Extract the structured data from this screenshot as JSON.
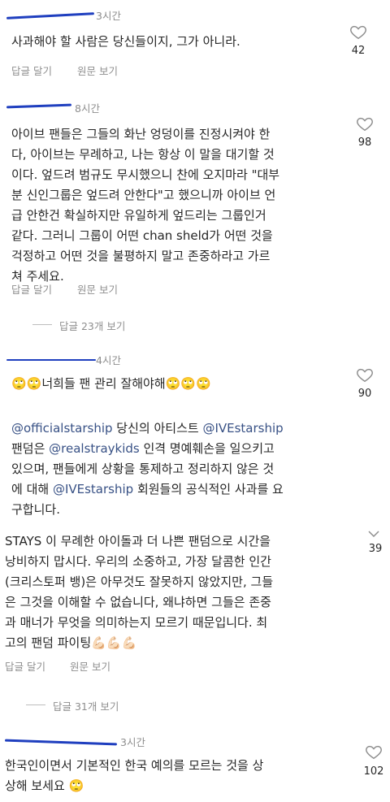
{
  "comments": [
    {
      "time": "3시간",
      "text": "사과해야 할 사람은 당신들이지, 그가 아니라.",
      "likes": "42",
      "reply_label": "답글 달기",
      "original_label": "원문 보기"
    },
    {
      "time": "8시간",
      "text": "아이브 팬들은 그들의 화난 엉덩이를 진정시켜야 한\n다, 아이브는 무례하고, 나는 항상 이 말을 대기할 것\n이다. 엎드려 범규도 무시했으니 찬에 오지마라 \"대부\n분 신인그룹은 엎드려 안한다\"고 했으니까 아이브 언\n급 안한건 확실하지만 유일하게 엎드리는 그룹인거\n같다. 그러니 그룹이 어떤 chan sheld가 어떤 것을\n걱정하고 어떤 것을 불평하지 말고 존중하라고 가르\n쳐 주세요.",
      "likes": "98",
      "reply_label": "답글 달기",
      "original_label": "원문 보기",
      "view_replies": "답글 23개 보기"
    },
    {
      "time": "4시간",
      "text": "🙄🙄너희들 팬 관리 잘해야해🙄🙄🙄",
      "likes": "90"
    },
    {
      "mentions": [
        "@officialstarship",
        "@IVEstarship",
        "@realstraykids",
        "@IVEstarship"
      ],
      "parts": [
        " 당신의 아티스트 ",
        "\n팬덤은 ",
        " 인격 명예훼손을 일으키고\n있으며, 팬들에게 상황을 통제하고 정리하지 않은 것\n에 대해 ",
        " 회원들의 공식적인 사과를 요\n구합니다."
      ]
    },
    {
      "text": "STAYS 이 무례한 아이돌과 더 나쁜 팬덤으로 시간을\n낭비하지 맙시다. 우리의 소중하고, 가장 달콤한 인간\n(크리스토퍼 뱅)은 아무것도 잘못하지 않았지만, 그들\n은 그것을 이해할 수 없습니다, 왜냐하면 그들은 존중\n과 매너가 무엇을 의미하는지 모르기 때문입니다. 최\n고의 팬덤 파이팅💪🏻💪🏻💪🏻",
      "likes": "39",
      "reply_label": "답글 달기",
      "original_label": "원문 보기",
      "view_replies": "답글 31개 보기"
    },
    {
      "time": "3시간",
      "text": "한국인이면서 기본적인 한국 예의를 모르는 것을 상\n상해 보세요 🙄",
      "likes": "102"
    }
  ],
  "icons": {
    "like": "heart-outline-icon",
    "collapse": "chevron-down-icon"
  },
  "colors": {
    "text": "#262626",
    "meta": "#8e8e8e",
    "mention": "#385185",
    "redaction": "#1f3fbf"
  }
}
